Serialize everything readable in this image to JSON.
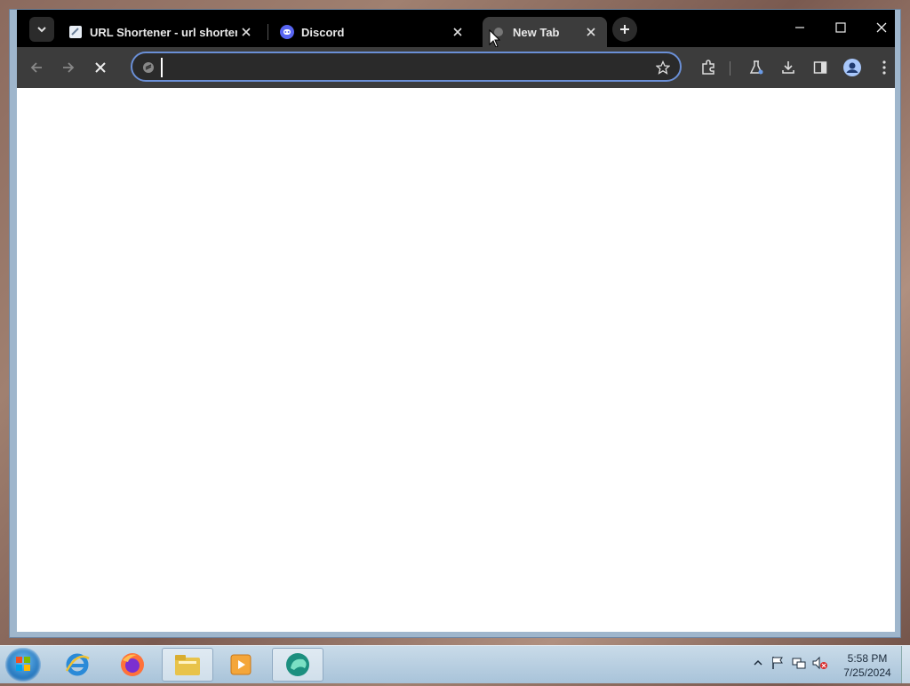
{
  "browser": {
    "tabs": [
      {
        "label": "URL Shortener - url shortening",
        "icon": "link-icon",
        "active": false
      },
      {
        "label": "Discord",
        "icon": "discord-icon",
        "active": false
      },
      {
        "label": "New Tab",
        "icon": "loading-icon",
        "active": true
      }
    ],
    "omnibox": {
      "value": "",
      "placeholder": ""
    }
  },
  "taskbar": {
    "apps": [
      "internet-explorer-icon",
      "firefox-icon",
      "file-explorer-icon",
      "media-player-icon",
      "browser-app-icon"
    ],
    "clock": {
      "time": "5:58 PM",
      "date": "7/25/2024"
    }
  },
  "colors": {
    "titlebar": "#000000",
    "toolbar": "#3c3c3c",
    "omnibox_border": "#6a8fd6",
    "content": "#ffffff"
  }
}
